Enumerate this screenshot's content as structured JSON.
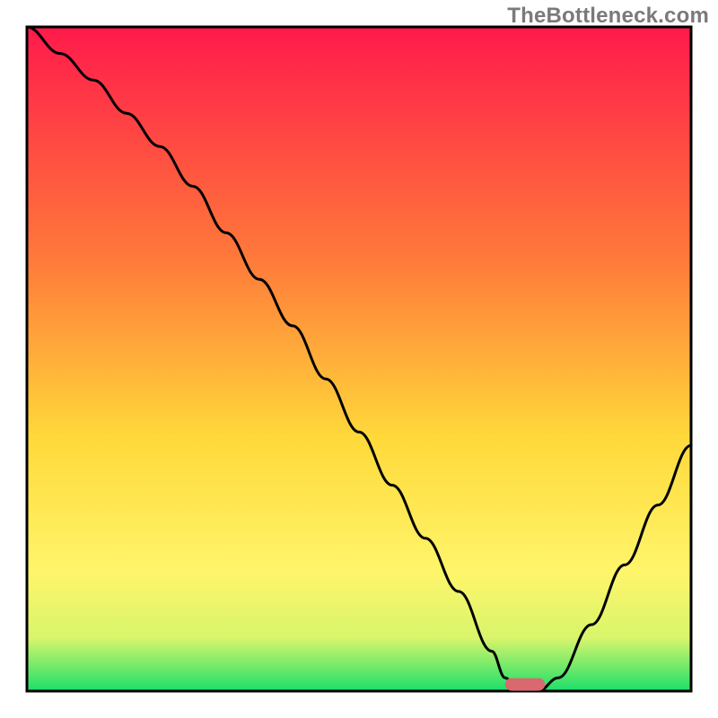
{
  "watermark": "TheBottleneck.com",
  "colors": {
    "gradient_top": "#ff1a4b",
    "gradient_mid1": "#ff7a3a",
    "gradient_mid2": "#ffd93a",
    "gradient_mid3": "#fff56b",
    "gradient_mid4": "#d8f56b",
    "gradient_bottom": "#1bdf6a",
    "frame": "#000000",
    "curve": "#000000",
    "marker_fill": "#d9686f"
  },
  "chart_data": {
    "type": "line",
    "title": "",
    "xlabel": "",
    "ylabel": "",
    "xlim": [
      0,
      100
    ],
    "ylim": [
      0,
      100
    ],
    "x": [
      0,
      5,
      10,
      15,
      20,
      25,
      30,
      35,
      40,
      45,
      50,
      55,
      60,
      65,
      70,
      72,
      74,
      77,
      80,
      85,
      90,
      95,
      100
    ],
    "values": [
      100,
      96,
      92,
      87,
      82,
      76,
      69,
      62,
      55,
      47,
      39,
      31,
      23,
      15,
      6,
      2,
      0,
      0,
      2,
      10,
      19,
      28,
      37
    ],
    "marker": {
      "x_start": 72,
      "x_end": 78,
      "y": 1
    }
  }
}
